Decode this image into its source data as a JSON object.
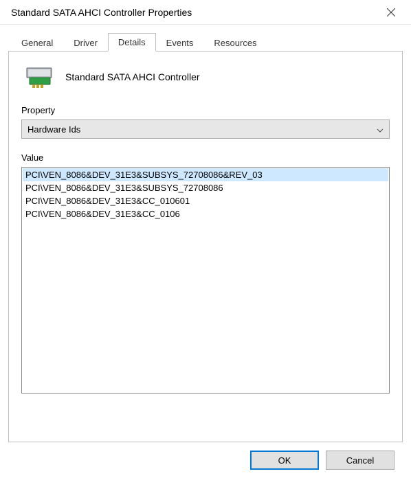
{
  "window": {
    "title": "Standard SATA AHCI Controller Properties"
  },
  "tabs": [
    {
      "label": "General"
    },
    {
      "label": "Driver"
    },
    {
      "label": "Details"
    },
    {
      "label": "Events"
    },
    {
      "label": "Resources"
    }
  ],
  "active_tab_index": 2,
  "device": {
    "name": "Standard SATA AHCI Controller"
  },
  "property": {
    "label": "Property",
    "selected": "Hardware Ids"
  },
  "value": {
    "label": "Value",
    "items": [
      "PCI\\VEN_8086&DEV_31E3&SUBSYS_72708086&REV_03",
      "PCI\\VEN_8086&DEV_31E3&SUBSYS_72708086",
      "PCI\\VEN_8086&DEV_31E3&CC_010601",
      "PCI\\VEN_8086&DEV_31E3&CC_0106"
    ],
    "selected_index": 0
  },
  "buttons": {
    "ok": "OK",
    "cancel": "Cancel"
  }
}
